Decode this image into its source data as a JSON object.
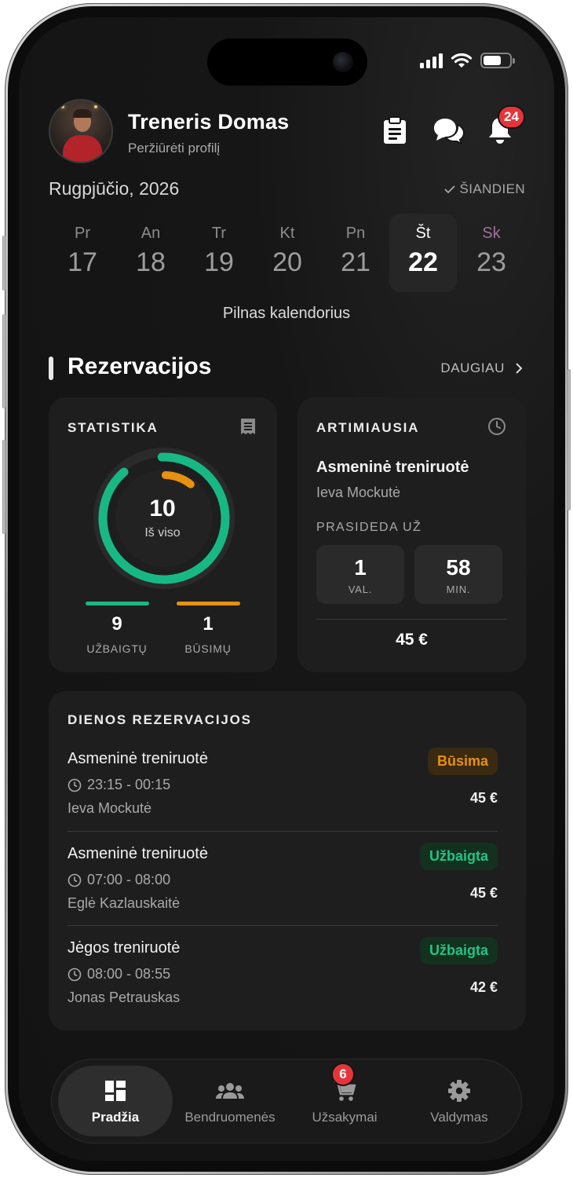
{
  "header": {
    "trainer_name": "Treneris Domas",
    "profile_link": "Peržiūrėti profilį",
    "notification_count": "24"
  },
  "calendar": {
    "month_label": "Rugpjūčio, 2026",
    "today_label": "ŠIANDIEN",
    "days": [
      {
        "name": "Pr",
        "date": "17"
      },
      {
        "name": "An",
        "date": "18"
      },
      {
        "name": "Tr",
        "date": "19"
      },
      {
        "name": "Kt",
        "date": "20"
      },
      {
        "name": "Pn",
        "date": "21"
      },
      {
        "name": "Št",
        "date": "22"
      },
      {
        "name": "Sk",
        "date": "23"
      }
    ],
    "selected_index": 5,
    "full_calendar_label": "Pilnas kalendorius"
  },
  "reservations": {
    "title": "Rezervacijos",
    "more_label": "DAUGIAU"
  },
  "stats": {
    "title": "STATISTIKA",
    "total": "10",
    "total_label": "Iš viso",
    "completed": "9",
    "completed_label": "UŽBAIGTŲ",
    "upcoming": "1",
    "upcoming_label": "BŪSIMŲ",
    "completed_color": "#18b884",
    "upcoming_color": "#e8900f"
  },
  "nearest": {
    "title": "ARTIMIAUSIA",
    "session_title": "Asmeninė treniruotė",
    "client": "Ieva Mockutė",
    "starts_in_label": "PRASIDEDA UŽ",
    "hours": "1",
    "hours_unit": "VAL.",
    "minutes": "58",
    "minutes_unit": "MIN.",
    "price": "45 €"
  },
  "daily": {
    "title": "DIENOS REZERVACIJOS",
    "items": [
      {
        "title": "Asmeninė treniruotė",
        "time": "23:15 - 00:15",
        "client": "Ieva Mockutė",
        "status": "Būsima",
        "price": "45 €"
      },
      {
        "title": "Asmeninė treniruotė",
        "time": "07:00 - 08:00",
        "client": "Eglė Kazlauskaitė",
        "status": "Užbaigta",
        "price": "45 €"
      },
      {
        "title": "Jėgos treniruotė",
        "time": "08:00 - 08:55",
        "client": "Jonas Petrauskas",
        "status": "Užbaigta",
        "price": "42 €"
      }
    ]
  },
  "tabbar": {
    "tabs": [
      {
        "label": "Pradžia",
        "icon": "dashboard-icon"
      },
      {
        "label": "Bendruomenės",
        "icon": "groups-icon"
      },
      {
        "label": "Užsakymai",
        "icon": "cart-icon"
      },
      {
        "label": "Valdymas",
        "icon": "gear-icon"
      }
    ],
    "cart_badge": "6",
    "active_index": 0
  }
}
